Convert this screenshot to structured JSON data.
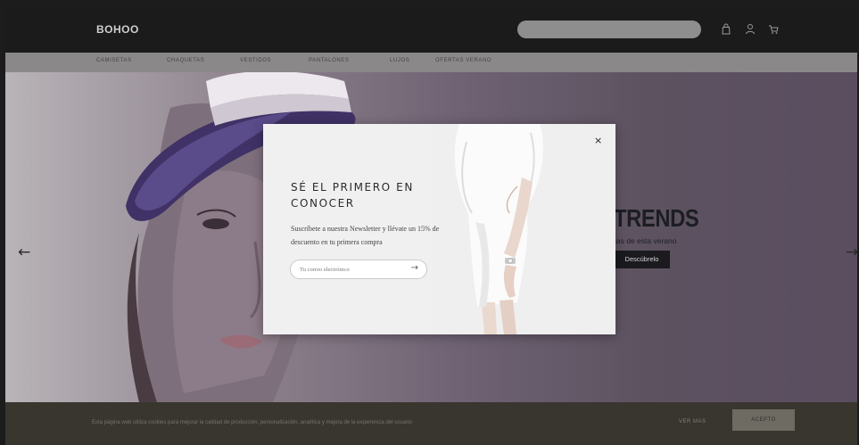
{
  "header": {
    "logo": "BOHOO",
    "search_placeholder": "",
    "icons": [
      "bag-icon",
      "user-icon",
      "cart-icon"
    ]
  },
  "nav": {
    "items": [
      {
        "label": "Camisetas"
      },
      {
        "label": "Chaquetas"
      },
      {
        "label": "Vestidos"
      },
      {
        "label": "Pantalones"
      },
      {
        "label": "Lujos"
      },
      {
        "label": "Ofertas Verano"
      }
    ]
  },
  "hero": {
    "title": "TRENDS",
    "subtitle": "ias de esta verano",
    "button_label": "Descúbrelo",
    "prev_arrow": "←",
    "next_arrow": "→"
  },
  "modal": {
    "title": "SÉ EL PRIMERO EN CONOCER",
    "description": "Suscríbete a nuestra Newsletter y llévate un 15% de descuento en tu primera compra",
    "email_placeholder": "Tu correo electrónico",
    "submit_arrow": "→",
    "close_label": "×"
  },
  "cookie": {
    "text": "Esta página web utiliza cookies para mejorar la calidad de producción, personalización, analítica y mejora de la experiencia del usuario",
    "more_label": "VER MAS",
    "accept_label": "ACEPTO"
  },
  "colors": {
    "topbar": "#1b1b1b",
    "navbar": "#8a8889",
    "cookie_bar": "#39362f",
    "modal_bg": "#f0f0f0",
    "hero_button": "#1a1a1f"
  }
}
